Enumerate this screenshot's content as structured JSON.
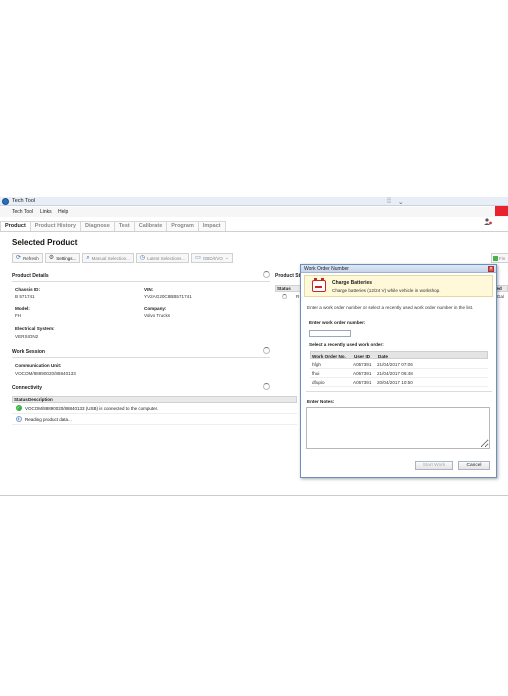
{
  "window": {
    "title": "Tech Tool",
    "controls": [
      "⁞⁞",
      "⌄"
    ]
  },
  "menu": [
    "Tech Tool",
    "Links",
    "Help"
  ],
  "tabs": [
    "Product",
    "Product History",
    "Diagnose",
    "Test",
    "Calibrate",
    "Program",
    "Impact"
  ],
  "page_title": "Selected Product",
  "toolbar": {
    "refresh": "Refresh",
    "settings": "Settings...",
    "manual_selection": "Manual Selection...",
    "latest_selections": "Latest Selections...",
    "obd": "OBD/I/VO",
    "right": "Fin"
  },
  "product_details": {
    "heading": "Product Details",
    "chassis_label": "Chassis ID:",
    "chassis_value": "B 571741",
    "vin_label": "VIN:",
    "vin_value": "YV2AG20C8BB571741",
    "model_label": "Model:",
    "model_value": "FH",
    "company_label": "Company:",
    "company_value": "Volvo Trucks",
    "electrical_label": "Electrical System:",
    "electrical_value": "VERSION2"
  },
  "work_session": {
    "heading": "Work Session",
    "comm_label": "Communication Unit:",
    "comm_value": "VOCOM/88890020/88840133"
  },
  "connectivity": {
    "heading": "Connectivity",
    "col_status": "Status",
    "col_desc": "Description",
    "rows": [
      "VOCOM/88890020/88840133 (USB) is connected to the computer.",
      "Reading product data..."
    ]
  },
  "product_status": {
    "heading": "Product St",
    "col_status": "Status",
    "right_col": "ted",
    "right_cell": "r/Ga/",
    "row_mark": "R"
  },
  "dialog": {
    "title": "Work Order Number",
    "banner_title": "Charge Batteries",
    "banner_text": "Charge batteries (12/24 V) while vehicle in workshop.",
    "instruction": "Enter a work order number or select a recently used work order number in the list.",
    "enter_label": "Enter work order number:",
    "enter_value": "",
    "recent_label": "Select a recently used work order:",
    "columns": [
      "Work Order No.",
      "User ID",
      "Date"
    ],
    "rows": [
      [
        "hfgh",
        "A057391",
        "21/04/2017 07:06"
      ],
      [
        "fhui",
        "A057391",
        "21/04/2017 06:48"
      ],
      [
        "dfupio",
        "A057391",
        "20/04/2017 10:50"
      ]
    ],
    "notes_label": "Enter Notes:",
    "start_button": "Start Work",
    "cancel_button": "Cancel"
  }
}
